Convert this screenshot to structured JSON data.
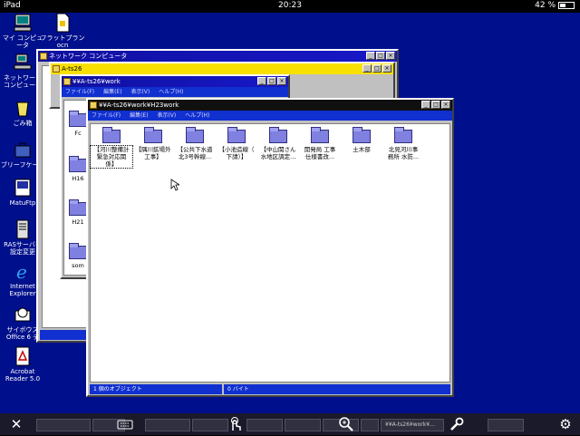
{
  "status": {
    "device": "iPad",
    "time": "20:23",
    "battery": "42 %"
  },
  "desktop_icons": [
    {
      "name": "my-computer",
      "label": "マイ コンピュータ"
    },
    {
      "name": "flat-plan",
      "label": "フラットプラン\nocn"
    },
    {
      "name": "network",
      "label": "ネットワーク\nコンピュータ"
    },
    {
      "name": "recycle",
      "label": "ごみ箱"
    },
    {
      "name": "briefcase",
      "label": "ブリーフケース"
    },
    {
      "name": "matsuftp",
      "label": "MatuFtp"
    },
    {
      "name": "ras-server",
      "label": "RASサーバー\n設定変更"
    },
    {
      "name": "ie",
      "label": "Internet\nExplorer"
    },
    {
      "name": "cybozu",
      "label": "サイボウズ\nOffice 6 デ"
    },
    {
      "name": "acrobat",
      "label": "Acrobat\nReader 5.0"
    }
  ],
  "windows": {
    "network": {
      "title": "ネットワーク コンピュータ"
    },
    "ats26": {
      "title": "A-ts26",
      "sidebar": [
        "Fc",
        "H16",
        "H21",
        "som"
      ]
    },
    "work": {
      "title": "¥¥A-ts26¥work",
      "menu": [
        "ファイル(F)",
        "編集(E)",
        "表示(V)",
        "ヘルプ(H)"
      ]
    },
    "h23work": {
      "title": "¥¥A-ts26¥work¥H23work",
      "menu": [
        "ファイル(F)",
        "編集(E)",
        "表示(V)",
        "ヘルプ(H)"
      ],
      "folders": [
        "【河川整備計\n緊急対応関\n係】",
        "【隅川鉱場外\n工事】",
        "【公共下水道\n北3号幹線...",
        "【小池造線（\n下請）】",
        "【中山関さん\n水地区調定...",
        "開発局 工事\n仕様書改...",
        "土木部",
        "北見河川事\n務所 水防..."
      ],
      "status": "1 個のオブジェクト",
      "status_right": "0 バイト"
    }
  },
  "taskbar": {
    "buttons": [
      "",
      "",
      "",
      "",
      "",
      "",
      "",
      "",
      "¥¥A-ts26¥work¥...",
      ""
    ]
  },
  "controls": [
    "close",
    "keyboard",
    "touch",
    "zoom",
    "settings",
    "gear"
  ]
}
